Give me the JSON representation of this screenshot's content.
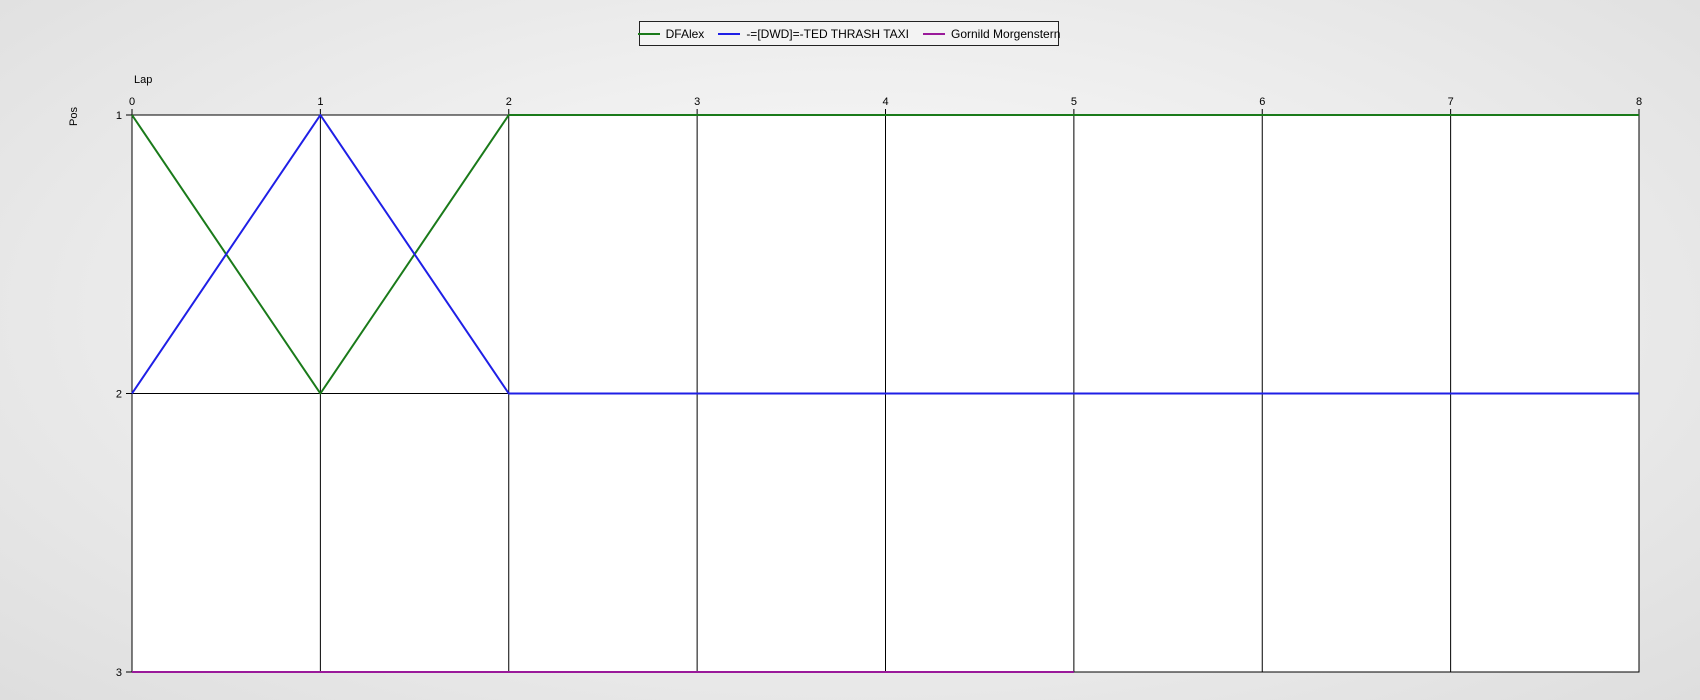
{
  "chart_data": {
    "type": "line",
    "title": "",
    "xlabel": "Lap",
    "ylabel": "Pos",
    "x_ticks": [
      "0",
      "1",
      "2",
      "3",
      "4",
      "5",
      "6",
      "7",
      "8"
    ],
    "y_ticks": [
      "1",
      "2",
      "3"
    ],
    "xlim": [
      0,
      8
    ],
    "ylim": [
      1,
      3
    ],
    "y_inverted": true,
    "grid": true,
    "legend_position": "top-center",
    "series": [
      {
        "name": "DFAlex",
        "color": "#1a7a1a",
        "x": [
          0,
          1,
          2,
          3,
          4,
          5,
          6,
          7,
          8
        ],
        "y": [
          1,
          2,
          1,
          1,
          1,
          1,
          1,
          1,
          1
        ]
      },
      {
        "name": "-=[DWD]=-TED THRASH TAXI",
        "color": "#1f1fe6",
        "x": [
          0,
          1,
          2,
          3,
          4,
          5,
          6,
          7,
          8
        ],
        "y": [
          2,
          1,
          2,
          2,
          2,
          2,
          2,
          2,
          2
        ]
      },
      {
        "name": "Gornild Morgenstern",
        "color": "#9a1a9a",
        "x": [
          0,
          1,
          2,
          3,
          4,
          5
        ],
        "y": [
          3,
          3,
          3,
          3,
          3,
          3
        ]
      }
    ]
  }
}
